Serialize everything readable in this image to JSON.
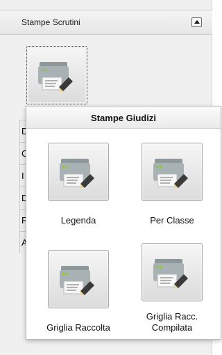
{
  "panel": {
    "title": "Stampe Scrutini",
    "collapse_icon": "collapse-arrow-up-icon",
    "selected_icon": "printer-icon",
    "side_rows": [
      "D",
      "C",
      "I",
      "D",
      "F",
      "A"
    ]
  },
  "popup": {
    "title": "Stampe Giudizi",
    "tiles": [
      {
        "label": "Legenda",
        "icon": "printer-icon"
      },
      {
        "label": "Per Classe",
        "icon": "printer-icon"
      },
      {
        "label": "Griglia Raccolta",
        "icon": "printer-icon"
      },
      {
        "label_line1": "Griglia Racc.",
        "label_line2": "Compilata",
        "icon": "printer-icon"
      }
    ]
  },
  "colors": {
    "printer_body": "#9aa3a6",
    "printer_dark": "#5e6c70",
    "printer_light": "#d5dbdd",
    "led_green": "#8dc63f",
    "pencil": "#3a3a3a"
  }
}
